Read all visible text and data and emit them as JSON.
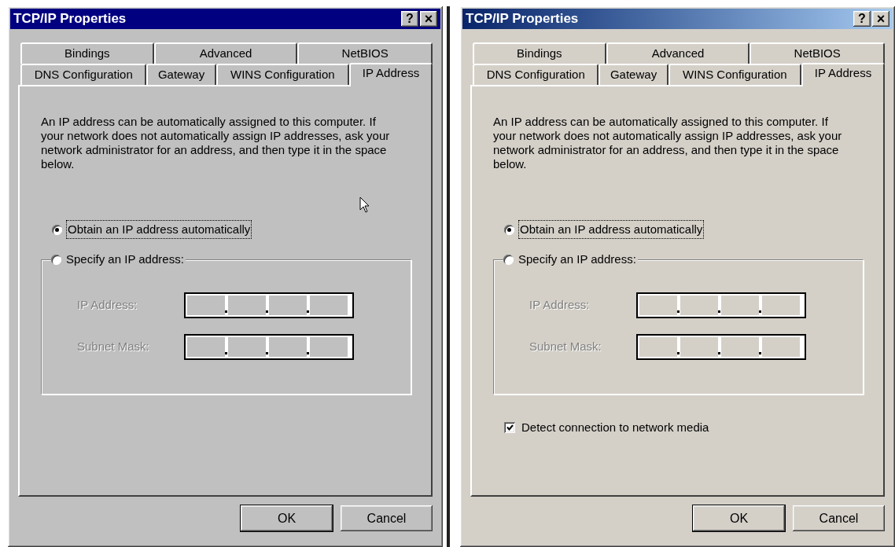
{
  "dialogs": [
    {
      "kind": "classic",
      "title": "TCP/IP Properties",
      "help_button": "?",
      "close_button": "×",
      "tab_rows": [
        [
          {
            "label": "Bindings",
            "selected": false
          },
          {
            "label": "Advanced",
            "selected": false
          },
          {
            "label": "NetBIOS",
            "selected": false
          }
        ],
        [
          {
            "label": "DNS Configuration",
            "selected": false
          },
          {
            "label": "Gateway",
            "selected": false
          },
          {
            "label": "WINS Configuration",
            "selected": false
          },
          {
            "label": "IP Address",
            "selected": true
          }
        ]
      ],
      "description": "An IP address can be automatically assigned to this computer. If your network does not automatically assign IP addresses, ask your network administrator for an address, and then type it in the space below.",
      "options": [
        {
          "label": "Obtain an IP address automatically",
          "selected": true,
          "focused": true
        },
        {
          "label": "Specify an IP address:",
          "selected": false,
          "focused": false
        }
      ],
      "fields": [
        {
          "label": "IP Address:",
          "disabled": true
        },
        {
          "label": "Subnet Mask:",
          "disabled": true
        }
      ],
      "cursor": true,
      "buttons": [
        "OK",
        "Cancel"
      ]
    },
    {
      "kind": "gradient",
      "title": "TCP/IP Properties",
      "help_button": "?",
      "close_button": "×",
      "tab_rows": [
        [
          {
            "label": "Bindings",
            "selected": false
          },
          {
            "label": "Advanced",
            "selected": false
          },
          {
            "label": "NetBIOS",
            "selected": false
          }
        ],
        [
          {
            "label": "DNS Configuration",
            "selected": false
          },
          {
            "label": "Gateway",
            "selected": false
          },
          {
            "label": "WINS Configuration",
            "selected": false
          },
          {
            "label": "IP Address",
            "selected": true
          }
        ]
      ],
      "description": "An IP address can be automatically assigned to this computer. If your network does not automatically assign IP addresses, ask your network administrator for an address, and then type it in the space below.",
      "options": [
        {
          "label": "Obtain an IP address automatically",
          "selected": true,
          "focused": true
        },
        {
          "label": "Specify an IP address:",
          "selected": false,
          "focused": false
        }
      ],
      "fields": [
        {
          "label": "IP Address:",
          "disabled": true
        },
        {
          "label": "Subnet Mask:",
          "disabled": true
        }
      ],
      "checkbox": {
        "label": "Detect connection to network media",
        "checked": true
      },
      "cursor": false,
      "buttons": [
        "OK",
        "Cancel"
      ]
    }
  ]
}
